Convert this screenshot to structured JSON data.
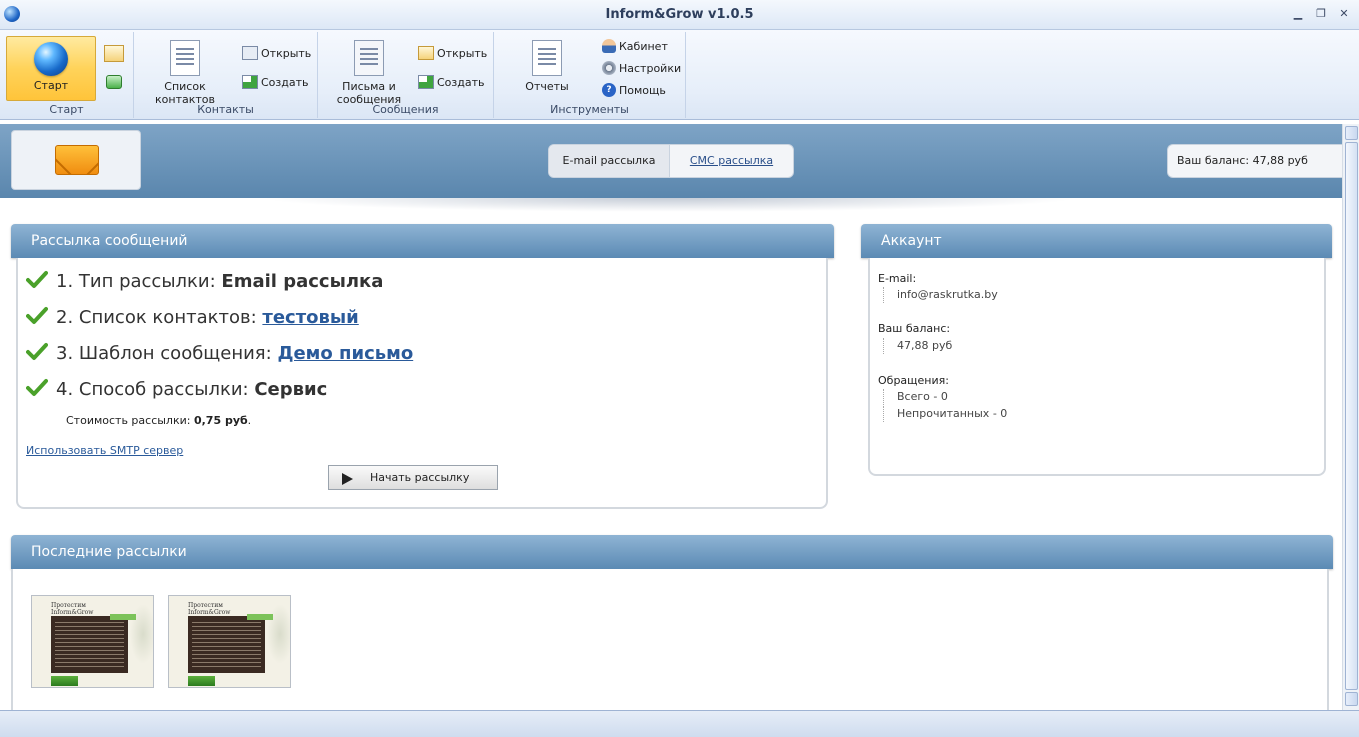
{
  "window": {
    "title": "Inform&Grow v1.0.5"
  },
  "ribbon": {
    "start": {
      "button": "Старт",
      "group": "Старт"
    },
    "contacts": {
      "big_button": "Список\nконтактов",
      "open": "Открыть",
      "create": "Создать",
      "group": "Контакты"
    },
    "messages": {
      "big_button": "Письма и\nсообщения",
      "open": "Открыть",
      "create": "Создать",
      "group": "Сообщения"
    },
    "tools": {
      "reports": "Отчеты",
      "cabinet": "Кабинет",
      "settings": "Настройки",
      "help": "Помощь",
      "group": "Инструменты"
    }
  },
  "banner": {
    "tabs": [
      "E-mail рассылка",
      "СМС рассылка"
    ],
    "balance": "Ваш баланс: 47,88 руб"
  },
  "mailing": {
    "title": "Рассылка сообщений",
    "steps": [
      {
        "label": "1. Тип рассылки:",
        "value": "Email рассылка",
        "link": false
      },
      {
        "label": "2. Список контактов:",
        "value": "тестовый",
        "link": true
      },
      {
        "label": "3. Шаблон сообщения:",
        "value": "Демо письмо",
        "link": true
      },
      {
        "label": "4. Способ рассылки:",
        "value": "Сервис",
        "link": false
      }
    ],
    "cost_label": "Стоимость рассылки:",
    "cost_value": "0,75 руб",
    "smtp_link": "Использовать SMTP сервер",
    "start_button": "Начать рассылку"
  },
  "account": {
    "title": "Аккаунт",
    "email_label": "E-mail:",
    "email_value": "info@raskrutka.by",
    "balance_label": "Ваш баланс:",
    "balance_value": "47,88 руб",
    "tickets_label": "Обращения:",
    "tickets_total": "Всего - 0",
    "tickets_unread": "Непрочитанных - 0"
  },
  "recent": {
    "title": "Последние рассылки",
    "thumb_heading": "Протестим\nInform&Grow"
  }
}
